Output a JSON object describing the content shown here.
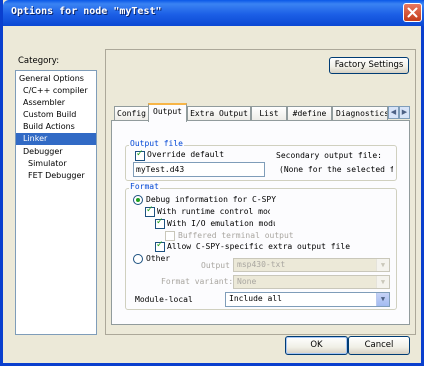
{
  "window": {
    "title": "Options for node \"myTest\""
  },
  "category": {
    "label": "Category:",
    "items": [
      {
        "label": "General Options"
      },
      {
        "label": "C/C++ compiler"
      },
      {
        "label": "Assembler"
      },
      {
        "label": "Custom Build"
      },
      {
        "label": "Build Actions"
      },
      {
        "label": "Linker",
        "selected": true
      },
      {
        "label": "Debugger"
      },
      {
        "label": "Simulator"
      },
      {
        "label": "FET Debugger"
      }
    ]
  },
  "factory_settings_label": "Factory Settings",
  "tabs": [
    {
      "label": "Config"
    },
    {
      "label": "Output",
      "active": true
    },
    {
      "label": "Extra Output"
    },
    {
      "label": "List"
    },
    {
      "label": "#define"
    },
    {
      "label": "Diagnostics"
    }
  ],
  "output_file": {
    "group_title": "Output file",
    "override_label": "Override default",
    "override_checked": true,
    "filename": "myTest.d43",
    "secondary_label": "Secondary output file:",
    "secondary_value": "(None for the selected fo"
  },
  "format": {
    "group_title": "Format",
    "debug_info_label": "Debug information for C-SPY",
    "runtime_label": "With runtime control mod",
    "io_emulation_label": "With I/O emulation modu",
    "buffered_label": "Buffered terminal output",
    "allow_extra_label": "Allow C-SPY-specific extra output file",
    "other_label": "Other",
    "output_label": "Output",
    "output_value": "msp430-txt",
    "format_variant_label": "Format variant:",
    "format_variant_value": "None",
    "module_local_label": "Module-local",
    "module_local_value": "Include all"
  },
  "buttons": {
    "ok": "OK",
    "cancel": "Cancel"
  },
  "colors": {
    "title_bar": "#0a58e8",
    "selection": "#316ac5",
    "group_title": "#0046d5",
    "check": "#21a121"
  }
}
